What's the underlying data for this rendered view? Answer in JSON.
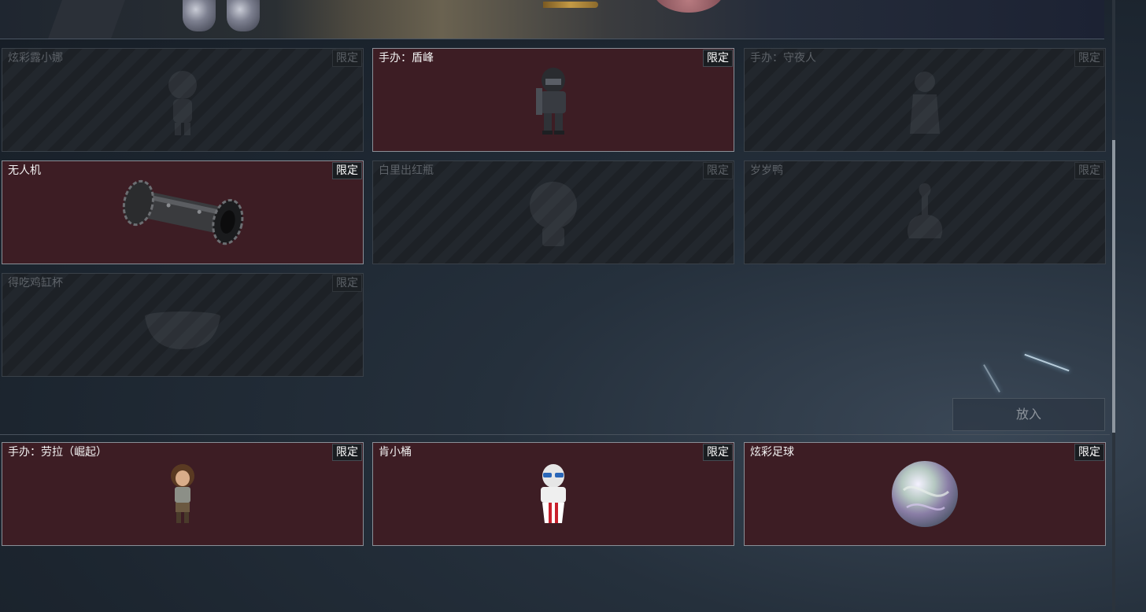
{
  "tag_label": "限定",
  "put_button": "放入",
  "grid": [
    {
      "name": "炫彩露小娜",
      "state": "locked",
      "icon": "doll-figure-icon"
    },
    {
      "name": "手办：盾峰",
      "state": "active",
      "icon": "armored-soldier-figure-icon"
    },
    {
      "name": "手办：守夜人",
      "state": "locked",
      "icon": "night-watcher-figure-icon"
    },
    {
      "name": "无人机",
      "state": "active",
      "icon": "drone-cylinder-icon"
    },
    {
      "name": "白里出红瓶",
      "state": "locked",
      "icon": "vase-icon"
    },
    {
      "name": "岁岁鸭",
      "state": "locked",
      "icon": "duck-icon"
    },
    {
      "name": "得吃鸡缸杯",
      "state": "locked",
      "icon": "bowl-cup-icon"
    }
  ],
  "bottom_row": [
    {
      "name": "手办：劳拉（崛起）",
      "state": "active",
      "icon": "lara-figure-icon"
    },
    {
      "name": "肯小桶",
      "state": "active",
      "icon": "colonel-bucket-figure-icon"
    },
    {
      "name": "炫彩足球",
      "state": "active",
      "icon": "iridescent-ball-icon"
    }
  ]
}
